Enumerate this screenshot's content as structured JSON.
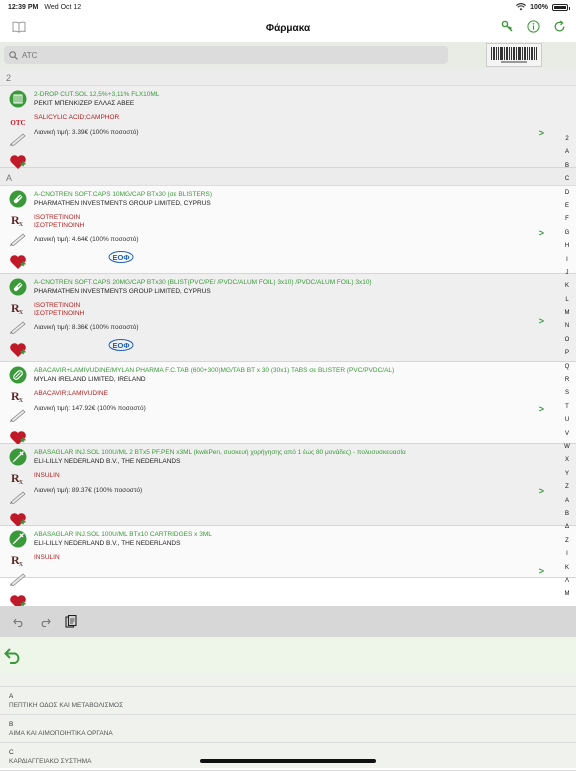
{
  "status_bar": {
    "time": "12:39 PM",
    "date": "Wed Oct 12",
    "battery": "100%",
    "battery_level": 1.0
  },
  "nav": {
    "title": "Φάρμακα"
  },
  "search": {
    "placeholder": "ATC"
  },
  "colors": {
    "accent": "#3a9a3a",
    "substance": "#b22222",
    "toolbar": "#d7d7d7"
  },
  "sections": [
    {
      "header": "2",
      "items": [
        {
          "type_icon": "pills-icon",
          "category": "OTC",
          "name": "2-DROP CUT.SOL 12,5%+3,11% FLX10ML",
          "company": "PEKIT ΜΠΕΝΚΙΖΕΡ ΕΛΛΑΣ ΑΒΕΕ",
          "substances": [
            "SALICYLIC ACID;CAMPHOR"
          ],
          "price": "Λιανική τιμή: 3.39€ (100% ποσοστό)",
          "eof": false
        }
      ]
    },
    {
      "header": "A",
      "items": [
        {
          "type_icon": "capsule-icon",
          "category": "Rx",
          "name": "A-CNOTREN SOFT.CAPS 10MG/CAP BTx30 (σε BLISTERS)",
          "company": "PHARMATHEN INVESTMENTS GROUP LIMITED, CYPRUS",
          "substances": [
            "ISOTRETINOIN",
            "ΙΣΟΤΡΕΤΙΝΟΙΝΗ"
          ],
          "price": "Λιανική τιμή: 4.64€ (100% ποσοστό)",
          "eof": true
        },
        {
          "type_icon": "capsule-icon",
          "category": "Rx",
          "name": "A-CNOTREN SOFT.CAPS 20MG/CAP BTx30 (BLIST(PVC/PE/ /PVDC/ALUM FOIL) 3x10) /PVDC/ALUM FOIL) 3x10)",
          "company": "PHARMATHEN INVESTMENTS GROUP LIMITED, CYPRUS",
          "substances": [
            "ISOTRETINOIN",
            "ΙΣΟΤΡΕΤΙΝΟΙΝΗ"
          ],
          "price": "Λιανική τιμή: 8.36€ (100% ποσοστό)",
          "eof": true
        },
        {
          "type_icon": "tablet-icon",
          "category": "Rx",
          "name": "ABACAVIR+LAMIVUDINE/MYLAN PHARMA F.C.TAB (600+300)MG/TAB BT x 30 (30x1) TABS σε BLISTER (PVC/PVDC/AL)",
          "company": "MYLAN IRELAND LIMITED, IRELAND",
          "substances": [
            "ABACAVIR;LAMIVUDINE"
          ],
          "price": "Λιανική τιμή: 147.92€ (100% ποσοστό)",
          "eof": false
        },
        {
          "type_icon": "injection-icon",
          "category": "Rx",
          "name": "ABASAGLAR INJ.SOL 100U/ML 2 BTx5 PF.PEN x3ML (kwikPen, συσκευή χορήγησης από 1 έως 80 μονάδες) - πολυσυσκευασία",
          "company": "ELI-LILLY NEDERLAND B.V., THE NEDERLANDS",
          "substances": [
            "INSULIN"
          ],
          "price": "Λιανική τιμή: 89.37€ (100% ποσοστό)",
          "eof": false
        },
        {
          "type_icon": "injection-icon",
          "category": "Rx",
          "name": "ABASAGLAR INJ.SOL 100U/ML BTx10 CARTRIDGES x 3ML",
          "company": "ELI-LILLY NEDERLAND B.V., THE NEDERLANDS",
          "substances": [
            "INSULIN"
          ],
          "price": "",
          "eof": false
        }
      ]
    }
  ],
  "eof_label": "ΕΟΦ",
  "chevron": ">",
  "index_letters": [
    "2",
    "A",
    "B",
    "C",
    "D",
    "E",
    "F",
    "G",
    "H",
    "I",
    "J",
    "K",
    "L",
    "M",
    "N",
    "O",
    "P",
    "Q",
    "R",
    "S",
    "T",
    "U",
    "V",
    "W",
    "X",
    "Y",
    "Z",
    "Α",
    "Β",
    "Δ",
    "Ζ",
    "Ι",
    "Κ",
    "Λ",
    "Μ"
  ],
  "atc_list": [
    {
      "code": "A",
      "desc": "ΠΕΠΤΙΚΗ ΟΔΟΣ ΚΑΙ ΜΕΤΑΒΟΛΙΣΜΟΣ"
    },
    {
      "code": "B",
      "desc": "ΑΙΜΑ ΚΑΙ ΑΙΜΟΠΟΙΗΤΙΚΑ ΟΡΓΑΝΑ"
    },
    {
      "code": "C",
      "desc": "ΚΑΡΔΙΑΓΓΕΙΑΚΟ ΣΥΣΤΗΜΑ"
    }
  ]
}
